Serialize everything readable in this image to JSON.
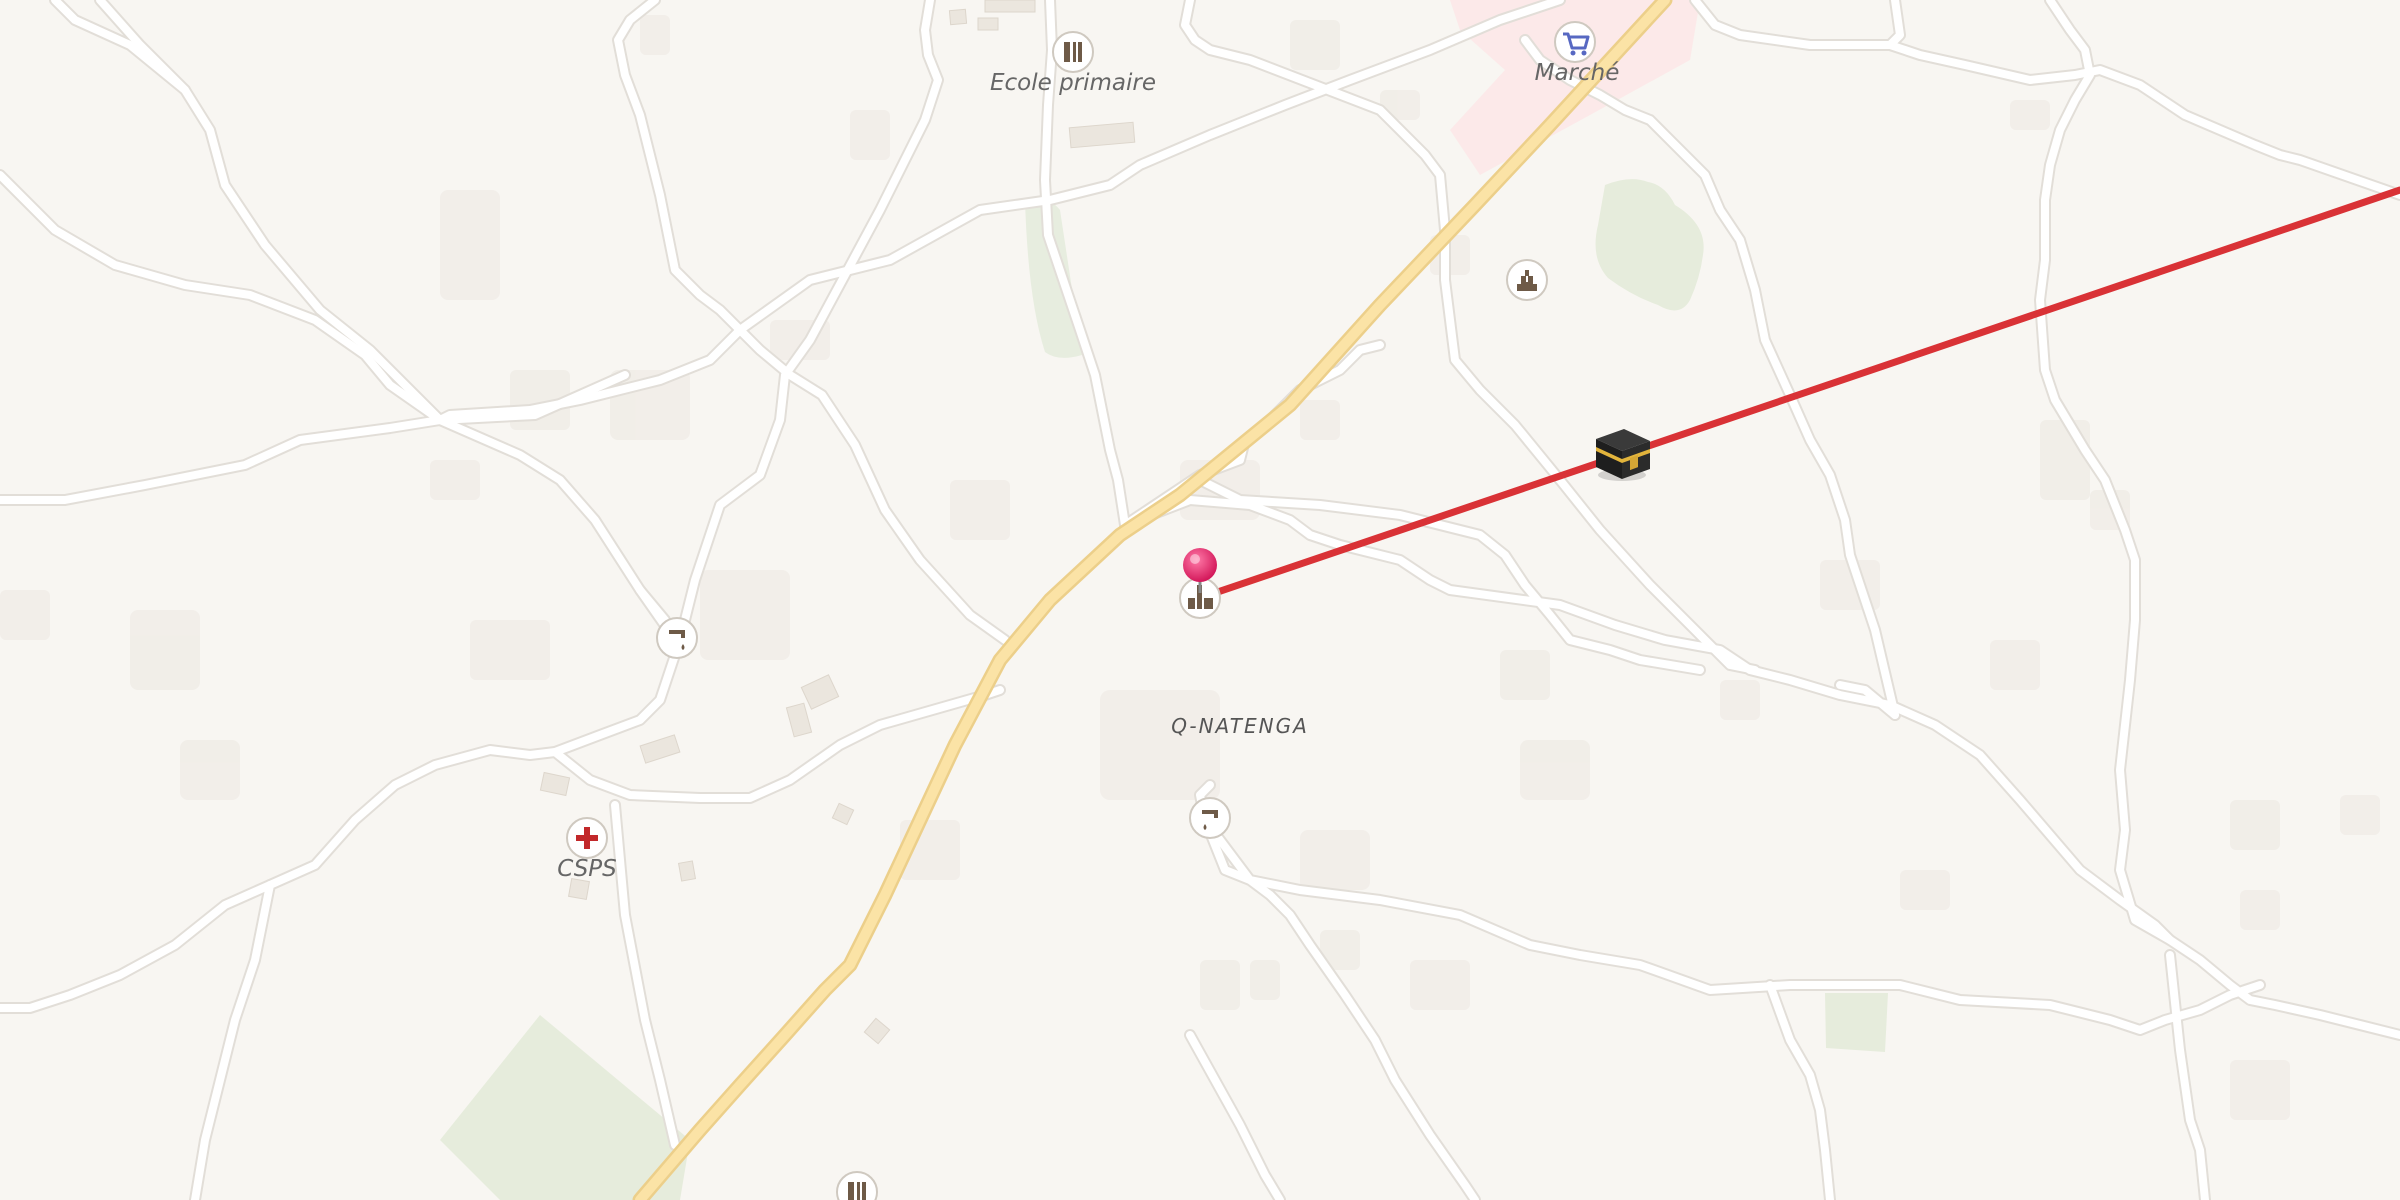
{
  "map": {
    "labels": {
      "ecole": "Ecole primaire",
      "marche": "Marché",
      "cs": "CSPS",
      "place": "Q-NATENGA"
    },
    "icons": {
      "school": "school-icon",
      "market": "shopping-cart-icon",
      "health": "health-cross-icon",
      "water": "water-tap-icon",
      "mosque": "mosque-icon",
      "monument": "monument-icon",
      "kaaba": "kaaba-icon",
      "pin": "location-pin-icon"
    },
    "colors": {
      "background": "#f8f6f2",
      "road_minor": "#ffffff",
      "road_casing": "#e2ded8",
      "road_primary": "#fbe3a6",
      "road_primary_casing": "#eccf8a",
      "qibla_line": "#d93236",
      "pin": "#ee2d6a",
      "green_area": "#e7eddf",
      "market_area": "#fde6e6",
      "building": "#ece8e1"
    },
    "qibla_line": "Direction line from pin toward the Kaaba"
  }
}
